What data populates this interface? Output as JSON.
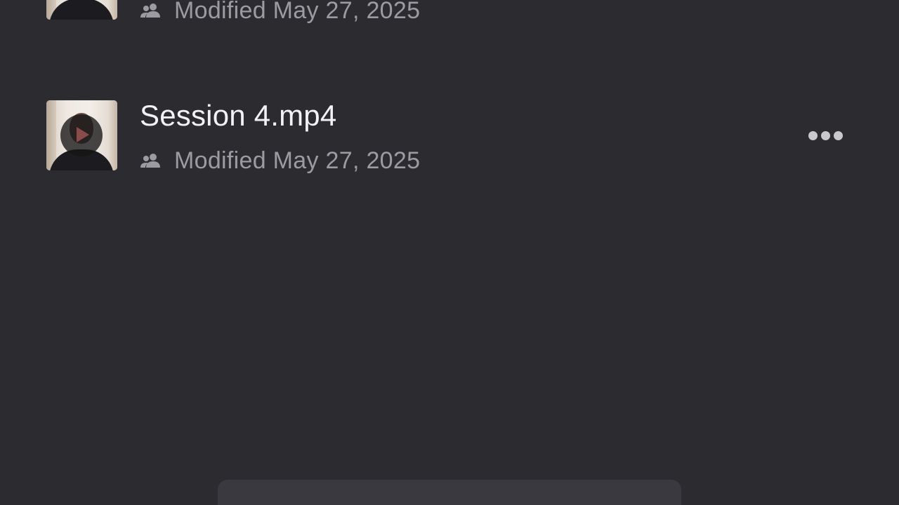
{
  "files": [
    {
      "name": "",
      "meta": "Modified May 27, 2025",
      "shared_icon": "people-icon",
      "has_more_button": false
    },
    {
      "name": "Session 4.mp4",
      "meta": "Modified May 27, 2025",
      "shared_icon": "people-icon",
      "thumbnail_icon": "play-icon",
      "more_icon": "ellipsis-icon",
      "has_more_button": true
    }
  ],
  "colors": {
    "background": "#2c2b30",
    "title": "#f2f2f4",
    "meta": "#9c9ba1",
    "bottom_bar": "#3a393f"
  }
}
